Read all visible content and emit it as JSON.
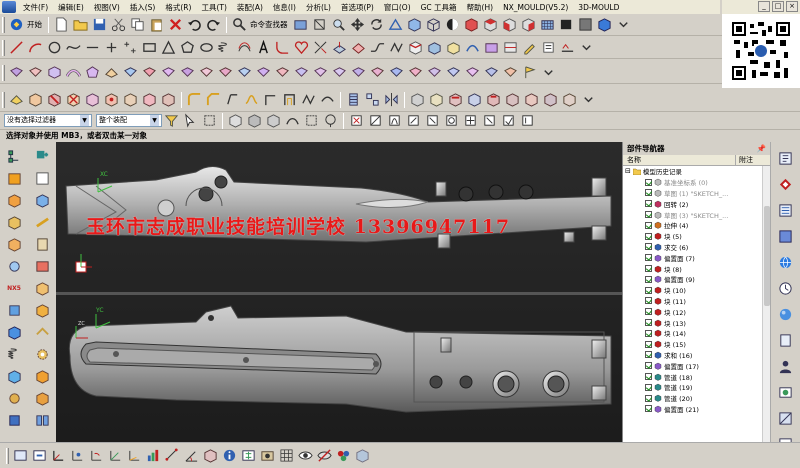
{
  "menu": {
    "items": [
      "文件(F)",
      "编辑(E)",
      "视图(V)",
      "插入(S)",
      "格式(R)",
      "工具(T)",
      "装配(A)",
      "信息(I)",
      "分析(L)",
      "首选项(P)",
      "窗口(O)",
      "GC 工具箱",
      "帮助(H)",
      "NX_MOULD(V5.2)",
      "3D-MOULD"
    ]
  },
  "window_buttons": [
    "_",
    "□",
    "×"
  ],
  "toolbar": {
    "start_label": "开始",
    "command_finder_label": "命令查找器"
  },
  "selection": {
    "filter_value": "没有选择过滤器",
    "scope_value": "整个装配"
  },
  "status_text": "选择对象并使用 MB3，或者双击某一对象",
  "watermark": "玉环市志成职业技能培训学校 13396947117",
  "left_toolbar": {
    "nx5_label": "NX5"
  },
  "viewport": {
    "axis_label_xc": "XC",
    "axis_label_yc": "YC",
    "axis_label_zc": "ZC"
  },
  "navigator": {
    "title": "部件导航器",
    "col_name": "名称",
    "col_note": "附注",
    "root": "模型历史记录",
    "nodes": [
      {
        "label": "基准坐标系 (0)",
        "icon": "datum-csys-icon",
        "dim": true
      },
      {
        "label": "草图 (1) \"SKETCH_...",
        "icon": "sketch-icon",
        "dim": true
      },
      {
        "label": "回转 (2)",
        "icon": "revolve-icon",
        "dim": false
      },
      {
        "label": "草图 (3) \"SKETCH_...",
        "icon": "sketch-icon",
        "dim": true
      },
      {
        "label": "拉伸 (4)",
        "icon": "extrude-icon",
        "dim": false
      },
      {
        "label": "块 (5)",
        "icon": "block-icon",
        "dim": false
      },
      {
        "label": "求交 (6)",
        "icon": "intersect-icon",
        "dim": false
      },
      {
        "label": "偏置面 (7)",
        "icon": "offset-face-icon",
        "dim": false
      },
      {
        "label": "块 (8)",
        "icon": "block-icon",
        "dim": false
      },
      {
        "label": "偏置面 (9)",
        "icon": "offset-face-icon",
        "dim": false
      },
      {
        "label": "块 (10)",
        "icon": "block-icon",
        "dim": false
      },
      {
        "label": "块 (11)",
        "icon": "block-icon",
        "dim": false
      },
      {
        "label": "块 (12)",
        "icon": "block-icon",
        "dim": false
      },
      {
        "label": "块 (13)",
        "icon": "block-icon",
        "dim": false
      },
      {
        "label": "块 (14)",
        "icon": "block-icon",
        "dim": false
      },
      {
        "label": "块 (15)",
        "icon": "block-icon",
        "dim": false
      },
      {
        "label": "求和 (16)",
        "icon": "unite-icon",
        "dim": false
      },
      {
        "label": "偏置面 (17)",
        "icon": "offset-face-icon",
        "dim": false
      },
      {
        "label": "管道 (18)",
        "icon": "tube-icon",
        "dim": false
      },
      {
        "label": "管道 (19)",
        "icon": "tube-icon",
        "dim": false
      },
      {
        "label": "管道 (20)",
        "icon": "tube-icon",
        "dim": false
      },
      {
        "label": "偏置面 (21)",
        "icon": "offset-face-icon",
        "dim": false
      }
    ]
  },
  "colors": {
    "watermark": "#e81919",
    "viewport_bg": "#242424",
    "part_gray": "#b8b8b8",
    "check_green": "#1a8a1a"
  }
}
